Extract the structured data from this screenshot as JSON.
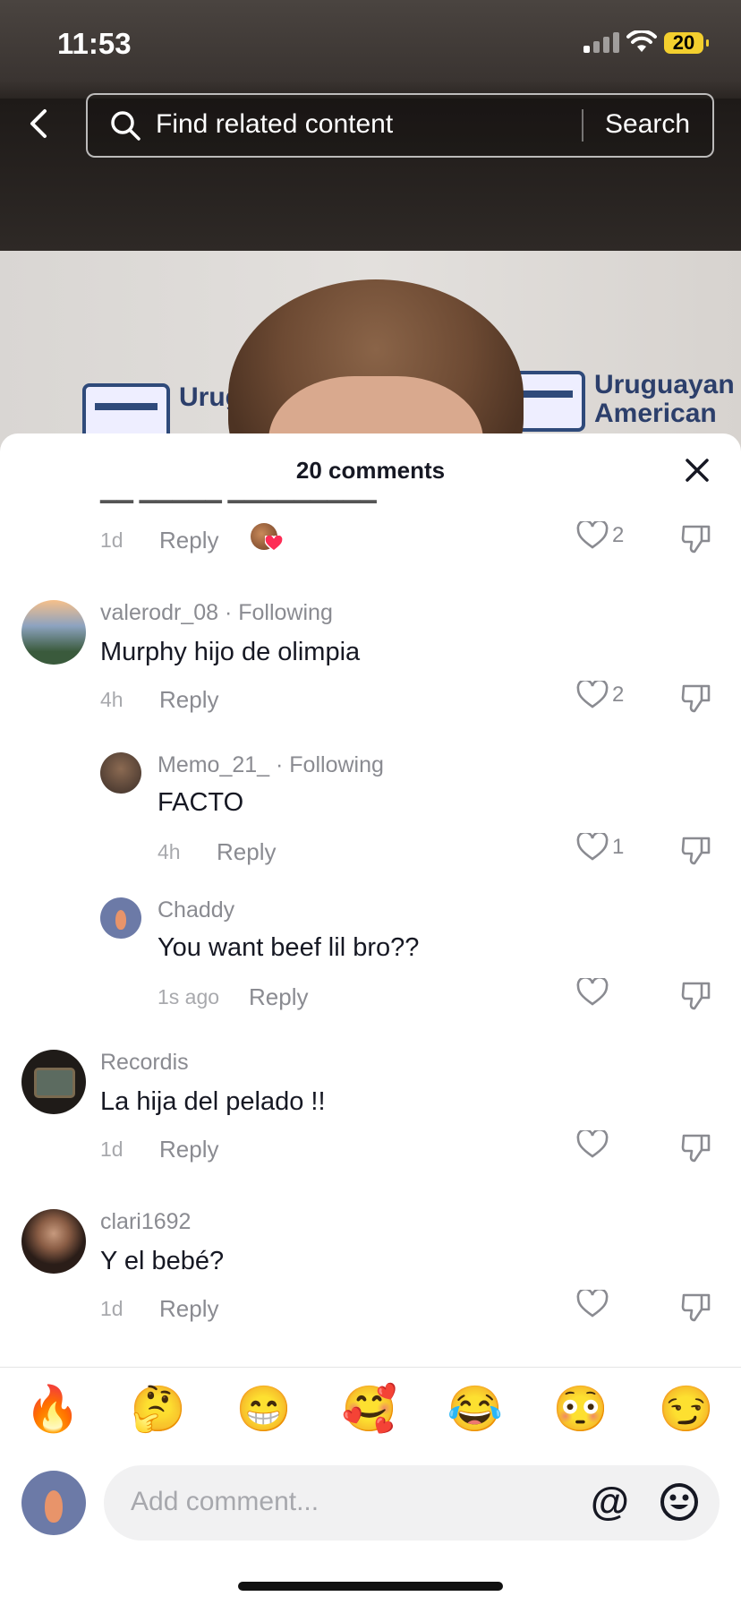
{
  "status_bar": {
    "time": "11:53",
    "battery": "20"
  },
  "search": {
    "placeholder": "Find related content",
    "button": "Search"
  },
  "video": {
    "banner_text_left": "Urug Ame",
    "banner_text_right": "Uruguayan American"
  },
  "sheet": {
    "title": "20 comments"
  },
  "comments": [
    {
      "user": "",
      "text": "",
      "time": "1d",
      "reply": "Reply",
      "likes": "2"
    },
    {
      "user": "valerodr_08 · Following",
      "text": "Murphy hijo de olimpia",
      "time": "4h",
      "reply": "Reply",
      "likes": "2"
    },
    {
      "user": "Memo_21_ · Following",
      "text": "FACTO",
      "time": "4h",
      "reply": "Reply",
      "likes": "1"
    },
    {
      "user": "Chaddy",
      "text": "You want beef lil bro??",
      "time": "1s ago",
      "reply": "Reply",
      "likes": ""
    },
    {
      "user": "Recordis",
      "text": "La hija del pelado !!",
      "time": "1d",
      "reply": "Reply",
      "likes": ""
    },
    {
      "user": "clari1692",
      "text": "Y el bebé?",
      "time": "1d",
      "reply": "Reply",
      "likes": ""
    }
  ],
  "emojis": [
    "🔥",
    "🤔",
    "😁",
    "🥰",
    "😂",
    "😳",
    "😏"
  ],
  "input": {
    "placeholder": "Add comment...",
    "mention": "@"
  },
  "icons": {
    "back": "chevron-left-icon",
    "search": "search-icon",
    "close": "close-icon",
    "like": "heart-icon",
    "dislike": "thumbs-down-icon",
    "emoji_picker": "smiley-icon"
  },
  "colors": {
    "text": "#161823",
    "muted": "#8a8b91",
    "battery": "#f3cf2e",
    "reaction_heart": "#fe2c55"
  }
}
